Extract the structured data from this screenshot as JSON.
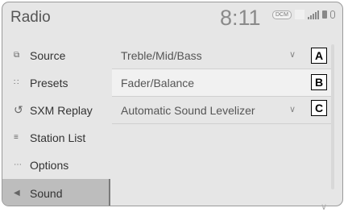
{
  "header": {
    "title": "Radio",
    "clock": "8:11",
    "status_badge": "DCM"
  },
  "sidebar": {
    "items": [
      {
        "label": "Source",
        "icon": "source-icon",
        "active": false
      },
      {
        "label": "Presets",
        "icon": "presets-icon",
        "active": false
      },
      {
        "label": "SXM Replay",
        "icon": "replay-icon",
        "active": false
      },
      {
        "label": "Station List",
        "icon": "station-list-icon",
        "active": false
      },
      {
        "label": "Options",
        "icon": "options-icon",
        "active": false
      },
      {
        "label": "Sound",
        "icon": "speaker-icon",
        "active": true
      }
    ]
  },
  "main": {
    "rows": [
      {
        "label": "Treble/Mid/Bass",
        "chevron": true,
        "callout": "A"
      },
      {
        "label": "Fader/Balance",
        "chevron": false,
        "callout": "B"
      },
      {
        "label": "Automatic Sound Levelizer",
        "chevron": true,
        "callout": "C"
      }
    ]
  }
}
